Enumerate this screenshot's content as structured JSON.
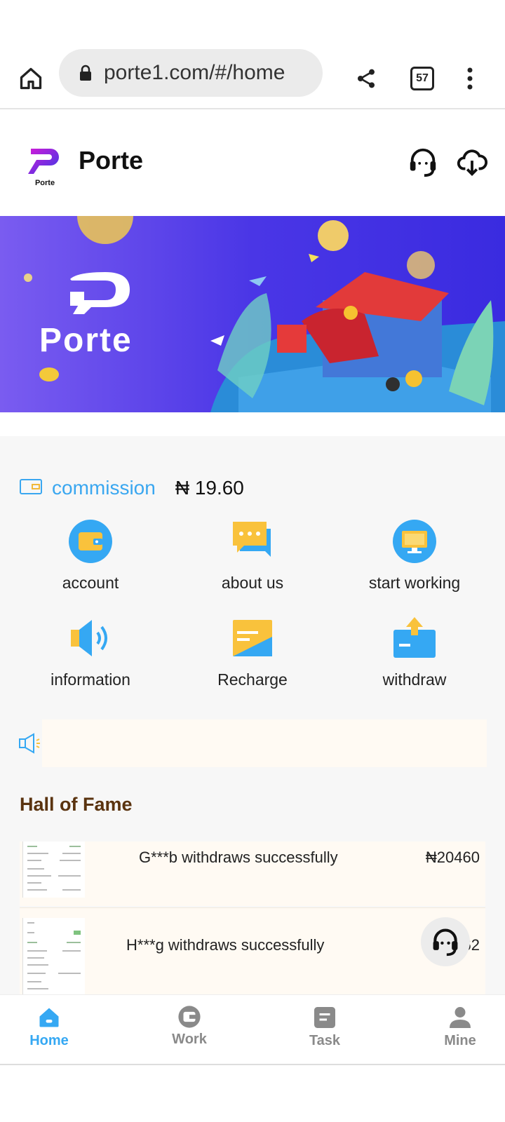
{
  "browser": {
    "url": "porte1.com/#/home",
    "tab_count": "57",
    "icons": [
      "home-icon",
      "lock-icon",
      "share-icon",
      "tabs-icon",
      "more-icon"
    ]
  },
  "header": {
    "logo_text": "Porte",
    "title": "Porte",
    "icons": [
      "headset-icon",
      "download-icon"
    ]
  },
  "banner": {
    "brand_text": "Porte"
  },
  "commission": {
    "label": "commission",
    "value": "₦ 19.60",
    "icon": "wallet-icon"
  },
  "menu": [
    {
      "label": "account",
      "icon": "wallet-icon",
      "color": "#35a8f3"
    },
    {
      "label": "about us",
      "icon": "chat-icon",
      "color": "#f9c23c"
    },
    {
      "label": "start working",
      "icon": "monitor-icon",
      "color": "#35a8f3"
    },
    {
      "label": "information",
      "icon": "speaker-icon",
      "color": "#35a8f3"
    },
    {
      "label": "Recharge",
      "icon": "card-icon",
      "color": "#f9c23c"
    },
    {
      "label": "withdraw",
      "icon": "withdraw-icon",
      "color": "#35a8f3"
    }
  ],
  "notice": {
    "icon": "megaphone-icon"
  },
  "hall_of_fame": {
    "title": "Hall of Fame",
    "rows": [
      {
        "message": "G***b withdraws successfully",
        "amount": "₦20460"
      },
      {
        "message": "H***g withdraws successfully",
        "amount": "₦18   .62"
      }
    ]
  },
  "bottom_nav": [
    {
      "label": "Home",
      "icon": "home-icon",
      "active": true
    },
    {
      "label": "Work",
      "icon": "work-icon",
      "active": false
    },
    {
      "label": "Task",
      "icon": "task-icon",
      "active": false
    },
    {
      "label": "Mine",
      "icon": "person-icon",
      "active": false
    }
  ],
  "colors": {
    "accent": "#35a8f3",
    "yellow": "#f9c23c",
    "title_brown": "#5a330f",
    "nav_inactive": "#8a8a8a"
  }
}
